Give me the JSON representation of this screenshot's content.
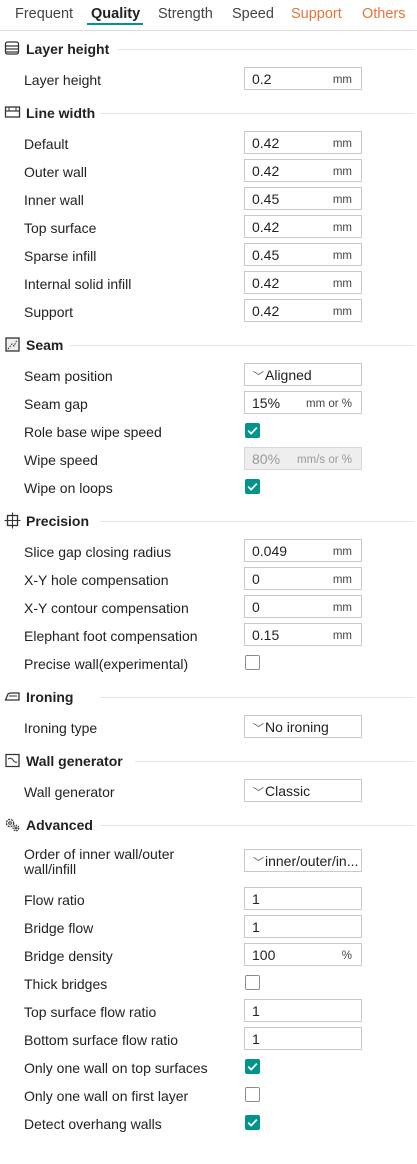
{
  "tabs": [
    {
      "label": "Frequent"
    },
    {
      "label": "Quality"
    },
    {
      "label": "Strength"
    },
    {
      "label": "Speed"
    },
    {
      "label": "Support"
    },
    {
      "label": "Others"
    }
  ],
  "active_tab": "Quality",
  "colors": {
    "accent": "#00958a",
    "highlight_tab": "#e8733c"
  },
  "sections": {
    "layer_height": {
      "title": "Layer height",
      "icon": "layers-icon",
      "rows": {
        "layer_height": {
          "label": "Layer height",
          "value": "0.2",
          "unit": "mm"
        }
      }
    },
    "line_width": {
      "title": "Line width",
      "icon": "line-width-icon",
      "rows": {
        "default": {
          "label": "Default",
          "value": "0.42",
          "unit": "mm"
        },
        "outer_wall": {
          "label": "Outer wall",
          "value": "0.42",
          "unit": "mm"
        },
        "inner_wall": {
          "label": "Inner wall",
          "value": "0.45",
          "unit": "mm"
        },
        "top_surface": {
          "label": "Top surface",
          "value": "0.42",
          "unit": "mm"
        },
        "sparse_infill": {
          "label": "Sparse infill",
          "value": "0.45",
          "unit": "mm"
        },
        "internal_solid_infill": {
          "label": "Internal solid infill",
          "value": "0.42",
          "unit": "mm"
        },
        "support": {
          "label": "Support",
          "value": "0.42",
          "unit": "mm"
        }
      }
    },
    "seam": {
      "title": "Seam",
      "icon": "seam-icon",
      "rows": {
        "seam_position": {
          "label": "Seam position",
          "value": "Aligned"
        },
        "seam_gap": {
          "label": "Seam gap",
          "value": "15%",
          "unit": "mm or %"
        },
        "role_base_wipe_speed": {
          "label": "Role base wipe speed",
          "checked": true
        },
        "wipe_speed": {
          "label": "Wipe speed",
          "value": "80%",
          "unit": "mm/s or %",
          "disabled": true
        },
        "wipe_on_loops": {
          "label": "Wipe on loops",
          "checked": true
        }
      }
    },
    "precision": {
      "title": "Precision",
      "icon": "precision-icon",
      "rows": {
        "slice_gap": {
          "label": "Slice gap closing radius",
          "value": "0.049",
          "unit": "mm"
        },
        "xy_hole": {
          "label": "X-Y hole compensation",
          "value": "0",
          "unit": "mm"
        },
        "xy_contour": {
          "label": "X-Y contour compensation",
          "value": "0",
          "unit": "mm"
        },
        "elephant_foot": {
          "label": "Elephant foot compensation",
          "value": "0.15",
          "unit": "mm"
        },
        "precise_wall": {
          "label": "Precise wall(experimental)",
          "checked": false
        }
      }
    },
    "ironing": {
      "title": "Ironing",
      "icon": "iron-icon",
      "rows": {
        "ironing_type": {
          "label": "Ironing type",
          "value": "No ironing"
        }
      }
    },
    "wall_generator": {
      "title": "Wall generator",
      "icon": "wall-generator-icon",
      "rows": {
        "wall_generator": {
          "label": "Wall generator",
          "value": "Classic"
        }
      }
    },
    "advanced": {
      "title": "Advanced",
      "icon": "gears-icon",
      "rows": {
        "wall_order": {
          "label": "Order of inner wall/outer wall/infill",
          "value": "inner/outer/in..."
        },
        "flow_ratio": {
          "label": "Flow ratio",
          "value": "1"
        },
        "bridge_flow": {
          "label": "Bridge flow",
          "value": "1"
        },
        "bridge_density": {
          "label": "Bridge density",
          "value": "100",
          "unit": "%"
        },
        "thick_bridges": {
          "label": "Thick bridges",
          "checked": false
        },
        "top_surface_flow": {
          "label": "Top surface flow ratio",
          "value": "1"
        },
        "bottom_surface_flow": {
          "label": "Bottom surface flow ratio",
          "value": "1"
        },
        "one_wall_top": {
          "label": "Only one wall on top surfaces",
          "checked": true
        },
        "one_wall_first": {
          "label": "Only one wall on first layer",
          "checked": false
        },
        "detect_overhang": {
          "label": "Detect overhang walls",
          "checked": true
        }
      }
    }
  }
}
